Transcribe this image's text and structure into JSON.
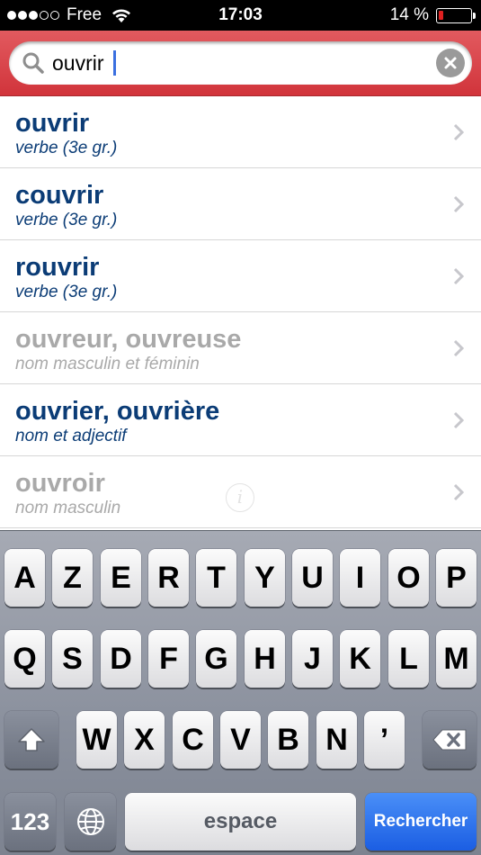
{
  "status_bar": {
    "carrier": "Free",
    "time": "17:03",
    "battery": "14 %",
    "signal_bars": 3
  },
  "search": {
    "value": "ouvrir"
  },
  "results": [
    {
      "word": "ouvrir",
      "type": "verbe (3e gr.)",
      "available": true
    },
    {
      "word": "couvrir",
      "type": "verbe (3e gr.)",
      "available": true
    },
    {
      "word": "rouvrir",
      "type": "verbe (3e gr.)",
      "available": true
    },
    {
      "word": "ouvreur, ouvreuse",
      "type": "nom masculin et féminin",
      "available": false
    },
    {
      "word": "ouvrier, ouvrière",
      "type": "nom et adjectif",
      "available": true
    },
    {
      "word": "ouvroir",
      "type": "nom masculin",
      "available": false
    }
  ],
  "keyboard": {
    "row1": [
      "A",
      "Z",
      "E",
      "R",
      "T",
      "Y",
      "U",
      "I",
      "O",
      "P"
    ],
    "row2": [
      "Q",
      "S",
      "D",
      "F",
      "G",
      "H",
      "J",
      "K",
      "L",
      "M"
    ],
    "row3": [
      "W",
      "X",
      "C",
      "V",
      "B",
      "N",
      "’"
    ],
    "numbers_label": "123",
    "space_label": "espace",
    "return_label": "Rechercher"
  },
  "colors": {
    "accent": "#d1343b",
    "word_available": "#0b3c76",
    "word_unavailable": "#a9a9a9",
    "return_key": "#1b5ee3"
  }
}
